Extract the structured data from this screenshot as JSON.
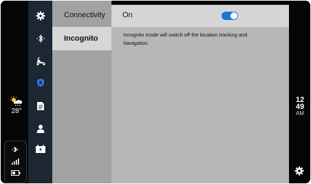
{
  "rail": {
    "items": [
      {
        "icon": "gear-icon"
      },
      {
        "icon": "bluetooth-icon"
      },
      {
        "icon": "scooter-icon"
      },
      {
        "icon": "shield-icon",
        "active": true
      },
      {
        "icon": "document-icon"
      },
      {
        "icon": "user-icon"
      },
      {
        "icon": "battery-charging-icon"
      }
    ]
  },
  "submenu": {
    "title": "Connectivity",
    "selected_item": "Incognito"
  },
  "content": {
    "header_label": "On",
    "toggle_on": true,
    "description": "Incognito mode will switch off the location tracking and Navigation."
  },
  "weather": {
    "icon": "partly-cloudy-rain-icon",
    "temperature": "28°"
  },
  "clock": {
    "hours": "12",
    "minutes": "49",
    "ampm": "AM"
  },
  "colors": {
    "accent": "#1e74d8",
    "rail_bg": "#1d2633",
    "active_icon": "#2a7be4"
  }
}
